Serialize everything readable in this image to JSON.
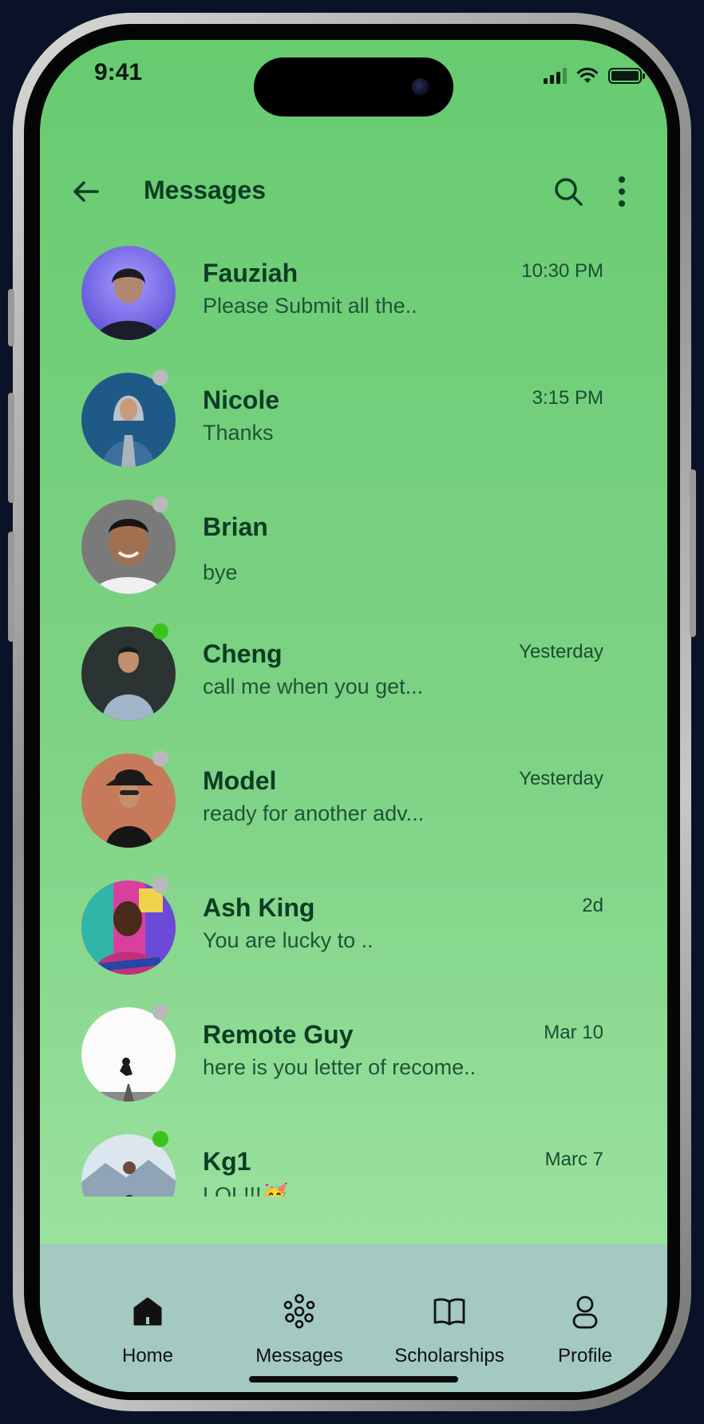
{
  "status_bar": {
    "time": "9:41"
  },
  "header": {
    "title": "Messages",
    "back_icon": "arrow-left-icon",
    "search_icon": "search-icon",
    "more_icon": "more-vertical-icon"
  },
  "conversations": [
    {
      "name": "Fauziah",
      "time": "10:30 PM",
      "preview": "Please Submit all the..",
      "presence": "none",
      "avatar": "purple-woman"
    },
    {
      "name": "Nicole",
      "time": "3:15 PM",
      "preview": "Thanks",
      "presence": "offline",
      "avatar": "blue-denim"
    },
    {
      "name": "Brian",
      "time": "",
      "preview": "bye",
      "presence": "offline",
      "avatar": "gray-man"
    },
    {
      "name": "Cheng",
      "time": "Yesterday",
      "preview": "call me when you get...",
      "presence": "online",
      "avatar": "dark-shirt"
    },
    {
      "name": "Model",
      "time": "Yesterday",
      "preview": "ready for another adv...",
      "presence": "offline",
      "avatar": "orange-hat"
    },
    {
      "name": "Ash King",
      "time": "2d",
      "preview": "You are lucky to ..",
      "presence": "offline",
      "avatar": "graffiti"
    },
    {
      "name": "Remote Guy",
      "time": "Mar 10",
      "preview": "here is you letter of recome..",
      "presence": "offline",
      "avatar": "white-road"
    },
    {
      "name": "Kg1",
      "time": "Marc 7",
      "preview": "LOL!!!🥳",
      "presence": "online",
      "avatar": "mountain"
    }
  ],
  "colors": {
    "online": "#3cc21f",
    "offline": "#b9b9b9",
    "accent": "#0c3d24"
  },
  "bottom_nav": [
    {
      "label": "Home",
      "icon": "home-icon",
      "active": true
    },
    {
      "label": "Messages",
      "icon": "messages-icon",
      "active": false
    },
    {
      "label": "Scholarships",
      "icon": "book-icon",
      "active": false
    },
    {
      "label": "Profile",
      "icon": "profile-icon",
      "active": false
    }
  ]
}
